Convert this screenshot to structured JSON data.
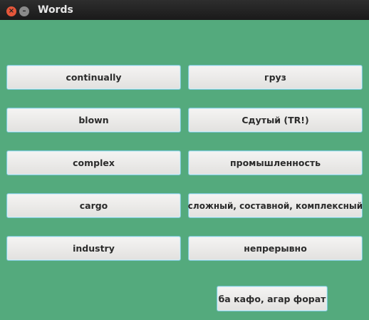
{
  "window": {
    "title": "Words"
  },
  "titlebar": {
    "close_glyph": "×",
    "minimize_glyph": "–"
  },
  "words": {
    "left": [
      "continually",
      "blown",
      "complex",
      "cargo",
      "industry"
    ],
    "right": [
      "груз",
      "Сдутый (TR!)",
      "промышленность",
      "сложный, составной, комплексный",
      "непрерывно"
    ]
  },
  "action_button": {
    "label": "ба кафо, агар форат"
  },
  "colors": {
    "background": "#54aa7d",
    "button_border": "#7cc7d6",
    "titlebar": "#222222"
  }
}
